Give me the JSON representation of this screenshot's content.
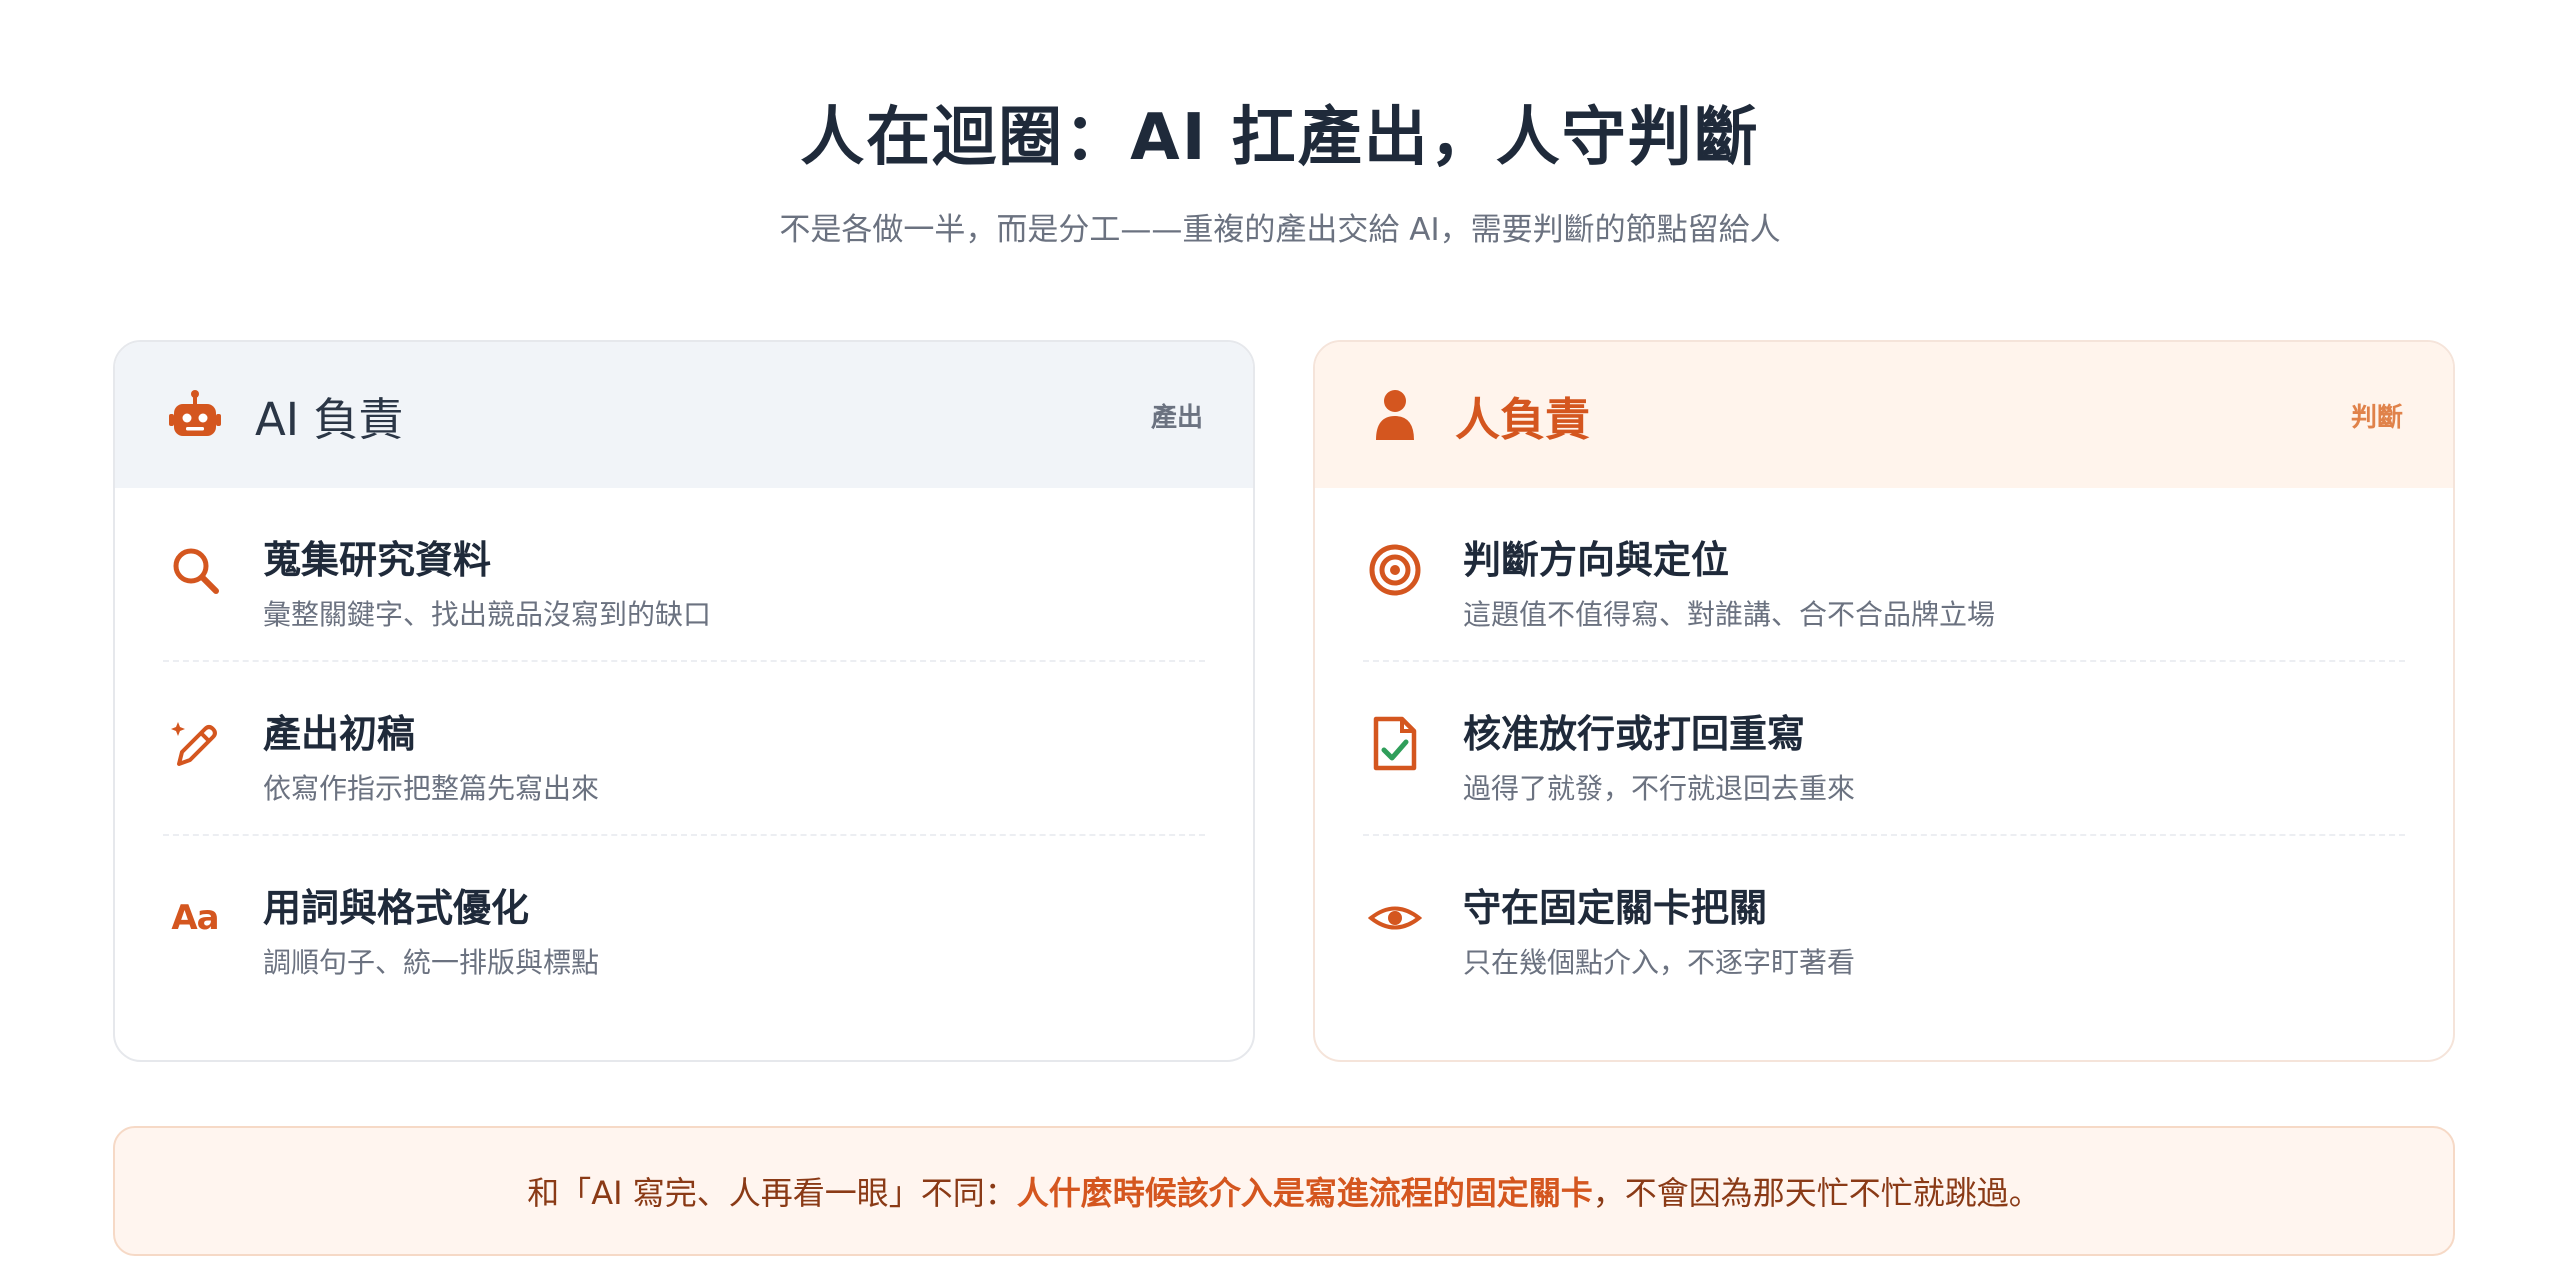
{
  "header": {
    "title": "人在迴圈：AI 扛產出，人守判斷",
    "subtitle": "不是各做一半，而是分工——重複的產出交給 AI，需要判斷的節點留給人"
  },
  "ai_card": {
    "title": "AI 負責",
    "tag": "產出",
    "icon": "robot-icon",
    "items": [
      {
        "icon": "search-icon",
        "title": "蒐集研究資料",
        "desc": "彙整關鍵字、找出競品沒寫到的缺口"
      },
      {
        "icon": "pencil-sparkle-icon",
        "title": "產出初稿",
        "desc": "依寫作指示把整篇先寫出來"
      },
      {
        "icon": "font-aa-icon",
        "icon_text": "Aa",
        "title": "用詞與格式優化",
        "desc": "調順句子、統一排版與標點"
      }
    ]
  },
  "human_card": {
    "title": "人負責",
    "tag": "判斷",
    "icon": "person-icon",
    "items": [
      {
        "icon": "target-icon",
        "title": "判斷方向與定位",
        "desc": "這題值不值得寫、對誰講、合不合品牌立場"
      },
      {
        "icon": "document-check-icon",
        "title": "核准放行或打回重寫",
        "desc": "過得了就發，不行就退回去重來"
      },
      {
        "icon": "eye-icon",
        "title": "守在固定關卡把關",
        "desc": "只在幾個點介入，不逐字盯著看"
      }
    ]
  },
  "note": {
    "prefix": "和「AI 寫完、人再看一眼」不同：",
    "emphasis": "人什麼時候該介入是寫進流程的固定關卡",
    "suffix": "，不會因為那天忙不忙就跳過。"
  },
  "colors": {
    "accent": "#d4561f",
    "ai_head_bg": "#f1f4f8",
    "human_head_bg": "#fff4ec",
    "note_bg": "#fff5ef"
  }
}
